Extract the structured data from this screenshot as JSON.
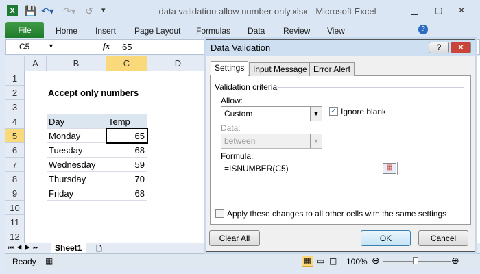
{
  "window": {
    "title": "data validation allow number only.xlsx - Microsoft Excel"
  },
  "ribbon": {
    "tabs": [
      "File",
      "Home",
      "Insert",
      "Page Layout",
      "Formulas",
      "Data",
      "Review",
      "View"
    ]
  },
  "formula_bar": {
    "name_box": "C5",
    "fx": "fx",
    "value": "65"
  },
  "columns": [
    "A",
    "B",
    "C",
    "D"
  ],
  "rows": [
    "1",
    "2",
    "3",
    "4",
    "5",
    "6",
    "7",
    "8",
    "9",
    "10",
    "11",
    "12"
  ],
  "sheet": {
    "heading": "Accept only numbers",
    "headers": [
      "Day",
      "Temp"
    ],
    "data": [
      [
        "Monday",
        "65"
      ],
      [
        "Tuesday",
        "68"
      ],
      [
        "Wednesday",
        "59"
      ],
      [
        "Thursday",
        "70"
      ],
      [
        "Friday",
        "68"
      ]
    ]
  },
  "sheet_tabs": [
    "Sheet1"
  ],
  "status": {
    "ready": "Ready",
    "zoom": "100%"
  },
  "dialog": {
    "title": "Data Validation",
    "tabs": [
      "Settings",
      "Input Message",
      "Error Alert"
    ],
    "group": "Validation criteria",
    "allow_label": "Allow:",
    "allow_value": "Custom",
    "ignore_blank": "Ignore blank",
    "data_label": "Data:",
    "data_value": "between",
    "formula_label": "Formula:",
    "formula_value": "=ISNUMBER(C5)",
    "apply_all": "Apply these changes to all other cells with the same settings",
    "clear_all": "Clear All",
    "ok": "OK",
    "cancel": "Cancel",
    "help": "?",
    "close": "✕"
  }
}
